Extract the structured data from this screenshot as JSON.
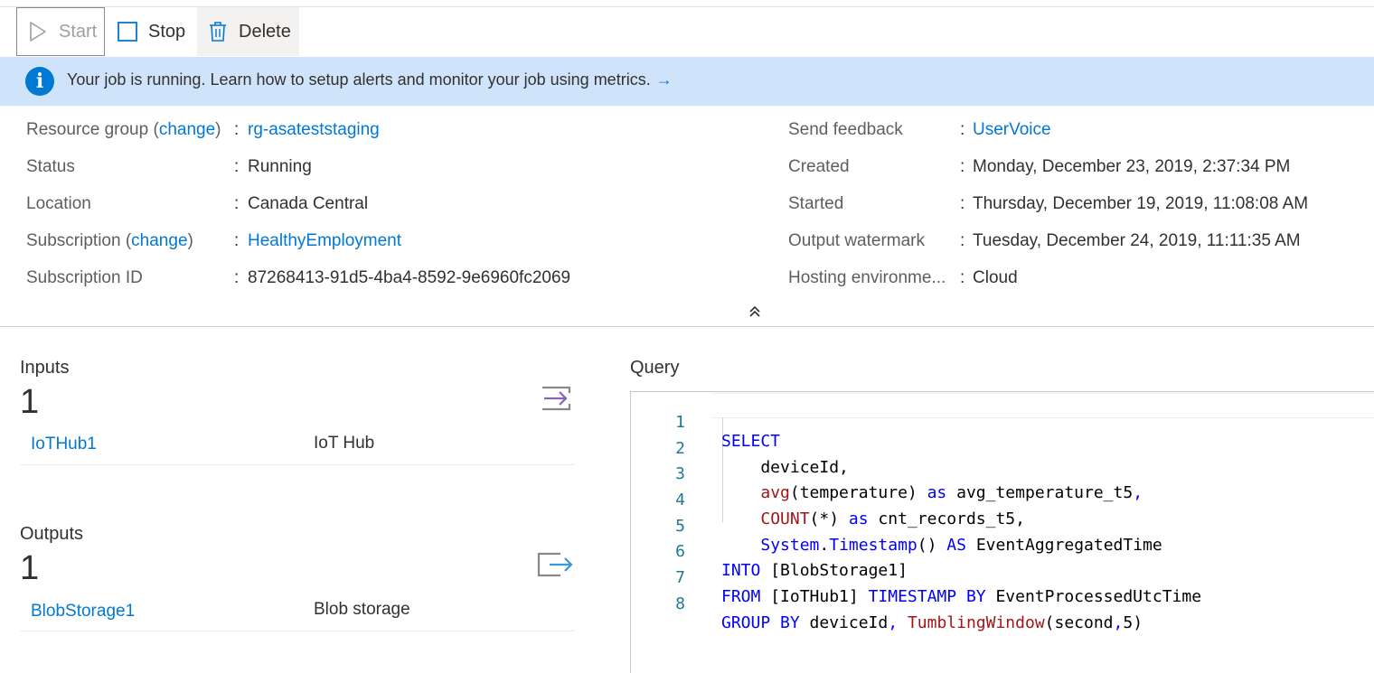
{
  "toolbar": {
    "start_label": "Start",
    "stop_label": "Stop",
    "delete_label": "Delete"
  },
  "banner": {
    "message": "Your job is running. Learn how to setup alerts and monitor your job using metrics.",
    "arrow": "→",
    "icon": "info-icon"
  },
  "essentials": {
    "left": [
      {
        "label": "Resource group",
        "change": "change",
        "value": "rg-asateststaging",
        "is_link": true
      },
      {
        "label": "Status",
        "value": "Running",
        "is_link": false
      },
      {
        "label": "Location",
        "value": "Canada Central",
        "is_link": false
      },
      {
        "label": "Subscription",
        "change": "change",
        "value": "HealthyEmployment",
        "is_link": true
      },
      {
        "label": "Subscription ID",
        "value": "87268413-91d5-4ba4-8592-9e6960fc2069",
        "is_link": false
      }
    ],
    "right": [
      {
        "label": "Send feedback",
        "value": "UserVoice",
        "is_link": true
      },
      {
        "label": "Created",
        "value": "Monday, December 23, 2019, 2:37:34 PM",
        "is_link": false
      },
      {
        "label": "Started",
        "value": "Thursday, December 19, 2019, 11:08:08 AM",
        "is_link": false
      },
      {
        "label": "Output watermark",
        "value": "Tuesday, December 24, 2019, 11:11:35 AM",
        "is_link": false
      },
      {
        "label": "Hosting environme...",
        "value": "Cloud",
        "is_link": false
      }
    ]
  },
  "inputs": {
    "title": "Inputs",
    "count": "1",
    "items": [
      {
        "name": "IoTHub1",
        "type": "IoT Hub"
      }
    ]
  },
  "outputs": {
    "title": "Outputs",
    "count": "1",
    "items": [
      {
        "name": "BlobStorage1",
        "type": "Blob storage"
      }
    ]
  },
  "query": {
    "title": "Query",
    "line_numbers": [
      "1",
      "2",
      "3",
      "4",
      "5",
      "6",
      "7",
      "8"
    ],
    "lines": [
      "SELECT",
      "    deviceId,",
      "    avg(temperature) as avg_temperature_t5,",
      "    COUNT(*) as cnt_records_t5,",
      "    System.Timestamp() AS EventAggregatedTime",
      "INTO [BlobStorage1]",
      "FROM [IoTHub1] TIMESTAMP BY EventProcessedUtcTime",
      "GROUP BY deviceId, TumblingWindow(second,5)"
    ]
  },
  "colors": {
    "accent": "#0078d4",
    "banner_bg": "#cfe4fa",
    "input_icon": "#8764b8",
    "output_icon": "#3a96dd"
  }
}
